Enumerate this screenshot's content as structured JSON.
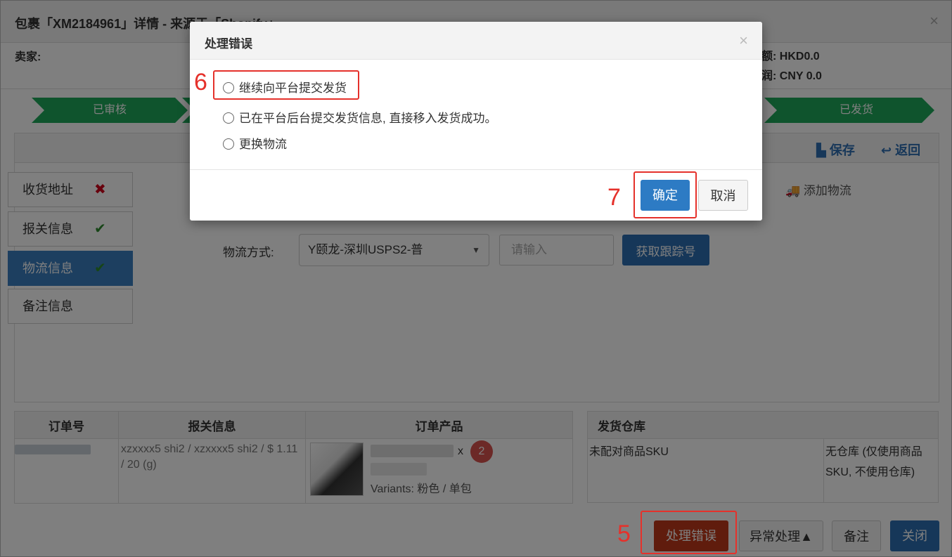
{
  "window": {
    "title": "包裹「XM2184961」详情 - 来源于「Shopify」",
    "close": "×",
    "seller_label": "卖家:",
    "total_amount": "总额: HKD0.0",
    "profit": "利润: CNY 0.0"
  },
  "steps": [
    "已审核",
    "已发货"
  ],
  "panel": {
    "save": "保存",
    "back": "返回",
    "add_shipping": "添加物流"
  },
  "tabs": [
    {
      "label": "收货地址",
      "status": "✖"
    },
    {
      "label": "报关信息",
      "status": "✔"
    },
    {
      "label": "物流信息",
      "status": "✔"
    },
    {
      "label": "备注信息",
      "status": ""
    }
  ],
  "shipping": {
    "method_label": "物流方式:",
    "method_value": "Y颐龙-深圳USPS2-普",
    "tracking_placeholder": "请输入",
    "get_tracking": "获取跟踪号"
  },
  "order_table": {
    "headers": [
      "订单号",
      "报关信息",
      "订单产品"
    ],
    "customs": "xzxxxx5 shi2 / xzxxxx5 shi2 / $ 1.11 / 20 (g)",
    "qty_prefix": "x",
    "qty": "2",
    "variants": "Variants: 粉色 / 单包"
  },
  "warehouse_table": {
    "header": "发货仓库",
    "unmatched": "未配对商品SKU",
    "note": "无仓库 (仅使用商品SKU, 不使用仓库)"
  },
  "bottom_buttons": {
    "handle_error": "处理错误",
    "exception": "异常处理▲",
    "remark": "备注",
    "close": "关闭"
  },
  "modal": {
    "title": "处理错误",
    "close": "×",
    "options": [
      "继续向平台提交发货",
      "已在平台后台提交发货信息, 直接移入发货成功。",
      "更换物流"
    ],
    "confirm": "确定",
    "cancel": "取消"
  },
  "annotations": [
    "5",
    "6",
    "7"
  ],
  "colors": {
    "step_green": "#1fa85a",
    "primary_blue": "#2d7bc4",
    "danger": "#c0391a",
    "annotation_red": "#e5312b"
  }
}
